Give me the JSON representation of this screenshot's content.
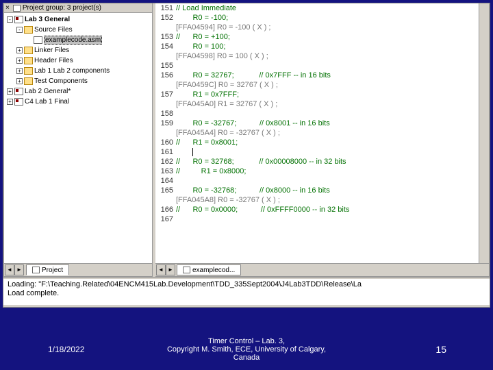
{
  "sidebar": {
    "header": "Project group: 3 project(s)",
    "nodes": [
      {
        "indent": 0,
        "toggle": "-",
        "icon": "proj",
        "label": "Lab 3 General",
        "bold": true
      },
      {
        "indent": 1,
        "toggle": "-",
        "icon": "folder-open",
        "label": "Source Files"
      },
      {
        "indent": 2,
        "toggle": "",
        "icon": "file",
        "label": "examplecode.asm",
        "selected": true
      },
      {
        "indent": 1,
        "toggle": "+",
        "icon": "folder",
        "label": "Linker Files"
      },
      {
        "indent": 1,
        "toggle": "+",
        "icon": "folder",
        "label": "Header Files"
      },
      {
        "indent": 1,
        "toggle": "+",
        "icon": "folder",
        "label": "Lab 1 Lab 2 components"
      },
      {
        "indent": 1,
        "toggle": "+",
        "icon": "folder",
        "label": "Test Components"
      },
      {
        "indent": 0,
        "toggle": "+",
        "icon": "proj",
        "label": "Lab 2 General*"
      },
      {
        "indent": 0,
        "toggle": "+",
        "icon": "proj",
        "label": "C4 Lab 1 Final"
      }
    ],
    "active_tab": "Project"
  },
  "editor": {
    "active_tab": "examplecod...",
    "lines": [
      {
        "num": "151",
        "kind": "green",
        "text": "// Load Immediate"
      },
      {
        "num": "152",
        "kind": "green",
        "text": "        R0 = -100;"
      },
      {
        "num": "",
        "kind": "gray",
        "text": "[FFA04594] R0 = -100 ( X ) ;"
      },
      {
        "num": "153",
        "kind": "green",
        "text": "//      R0 = +100;"
      },
      {
        "num": "154",
        "kind": "green",
        "text": "        R0 = 100;"
      },
      {
        "num": "",
        "kind": "gray",
        "text": "[FFA04598] R0 = 100 ( X ) ;"
      },
      {
        "num": "155",
        "kind": "plain",
        "text": ""
      },
      {
        "num": "156",
        "kind": "green",
        "text": "        R0 = 32767;            // 0x7FFF -- in 16 bits"
      },
      {
        "num": "",
        "kind": "gray",
        "text": "[FFA0459C] R0 = 32767 ( X ) ;"
      },
      {
        "num": "157",
        "kind": "green",
        "text": "        R1 = 0x7FFF;"
      },
      {
        "num": "",
        "kind": "gray",
        "text": "[FFA045A0] R1 = 32767 ( X ) ;"
      },
      {
        "num": "158",
        "kind": "plain",
        "text": ""
      },
      {
        "num": "159",
        "kind": "green",
        "text": "        R0 = -32767;           // 0x8001 -- in 16 bits"
      },
      {
        "num": "",
        "kind": "gray",
        "text": "[FFA045A4] R0 = -32767 ( X ) ;"
      },
      {
        "num": "160",
        "kind": "green",
        "text": "//      R1 = 0x8001;"
      },
      {
        "num": "161",
        "kind": "plain",
        "text": "        ",
        "cursor": true
      },
      {
        "num": "162",
        "kind": "green",
        "text": "//      R0 = 32768;            // 0x00008000 -- in 32 bits"
      },
      {
        "num": "163",
        "kind": "green",
        "text": "//          R1 = 0x8000;"
      },
      {
        "num": "164",
        "kind": "plain",
        "text": ""
      },
      {
        "num": "165",
        "kind": "green",
        "text": "        R0 = -32768;           // 0x8000 -- in 16 bits"
      },
      {
        "num": "",
        "kind": "gray",
        "text": "[FFA045A8] R0 = -32767 ( X ) ;"
      },
      {
        "num": "166",
        "kind": "green",
        "text": "//      R0 = 0x0000;           // 0xFFFF0000 -- in 32 bits"
      },
      {
        "num": "167",
        "kind": "plain",
        "text": ""
      }
    ]
  },
  "console": {
    "lines": [
      "Loading: \"F:\\Teaching.Related\\04ENCM415Lab.Development\\TDD_335Sept2004\\J4Lab3TDD\\Release\\La",
      "Load complete."
    ]
  },
  "footer": {
    "date": "1/18/2022",
    "title_line1": "Timer Control – Lab. 3,",
    "title_line2": "Copyright M. Smith, ECE, University of Calgary,",
    "title_line3": "Canada",
    "page": "15"
  }
}
